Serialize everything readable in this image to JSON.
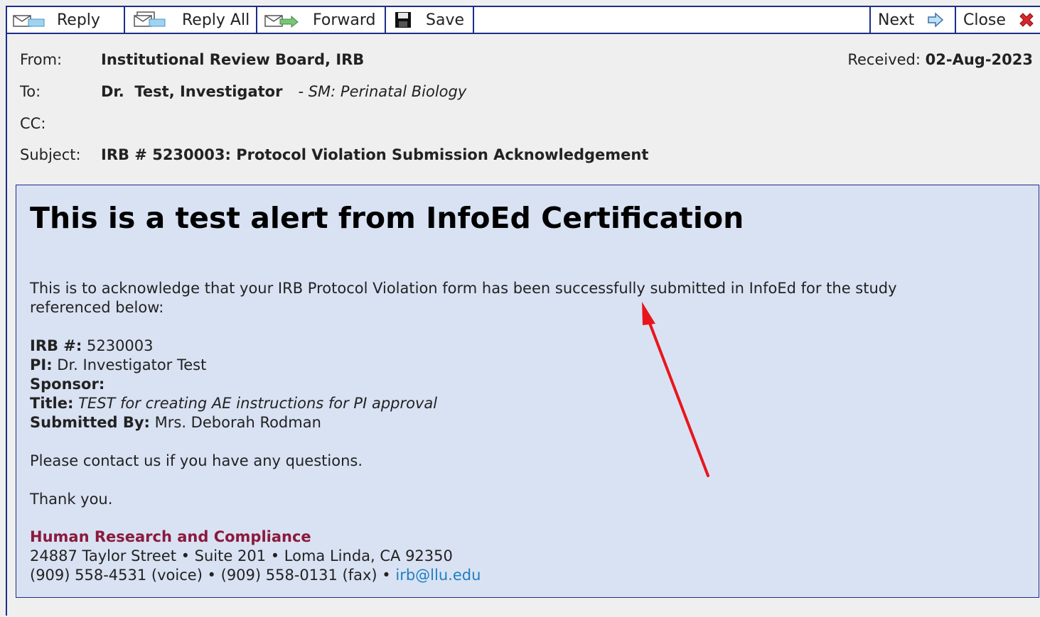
{
  "toolbar": {
    "reply": "Reply",
    "reply_all": "Reply All",
    "forward": "Forward",
    "save": "Save",
    "next": "Next",
    "close": "Close"
  },
  "header": {
    "from_label": "From:",
    "from_value": "Institutional Review Board, IRB",
    "received_label": "Received:",
    "received_value": "02-Aug-2023",
    "to_label": "To:",
    "to_value": "Dr.  Test, Investigator",
    "to_dept": "- SM: Perinatal Biology",
    "cc_label": "CC:",
    "cc_value": "",
    "subject_label": "Subject:",
    "subject_value": "IRB # 5230003: Protocol Violation Submission Acknowledgement"
  },
  "message": {
    "heading": "This is a test alert from InfoEd Certification",
    "intro_line1": "This is to acknowledge that your IRB Protocol Violation form has been successfully submitted in InfoEd for the study",
    "intro_line2": "referenced below:",
    "irb_label": "IRB #:",
    "irb_value": "5230003",
    "pi_label": "PI:",
    "pi_value": "Dr. Investigator Test",
    "sponsor_label": "Sponsor:",
    "sponsor_value": "",
    "title_label": "Title:",
    "title_value": "TEST for creating AE instructions for PI approval",
    "submitted_label": "Submitted By:",
    "submitted_value": "Mrs. Deborah Rodman",
    "contact": "Please contact us if you have any questions.",
    "thanks": "Thank you.",
    "org_name": "Human Research and Compliance",
    "address": "24887 Taylor Street • Suite 201 • Loma Linda, CA 92350",
    "phone": "(909) 558-4531 (voice) • (909) 558-0131 (fax) •",
    "email": "irb@llu.edu"
  },
  "colors": {
    "border": "#1d2d86",
    "body_bg": "#d9e2f3",
    "org": "#8b1a3c",
    "link": "#1f7fbf",
    "annotation_arrow": "#e8161c"
  },
  "icons": [
    "envelope-icon",
    "envelope-reply-all-icon",
    "envelope-forward-icon",
    "floppy-save-icon",
    "arrow-right-icon",
    "red-x-close-icon"
  ]
}
